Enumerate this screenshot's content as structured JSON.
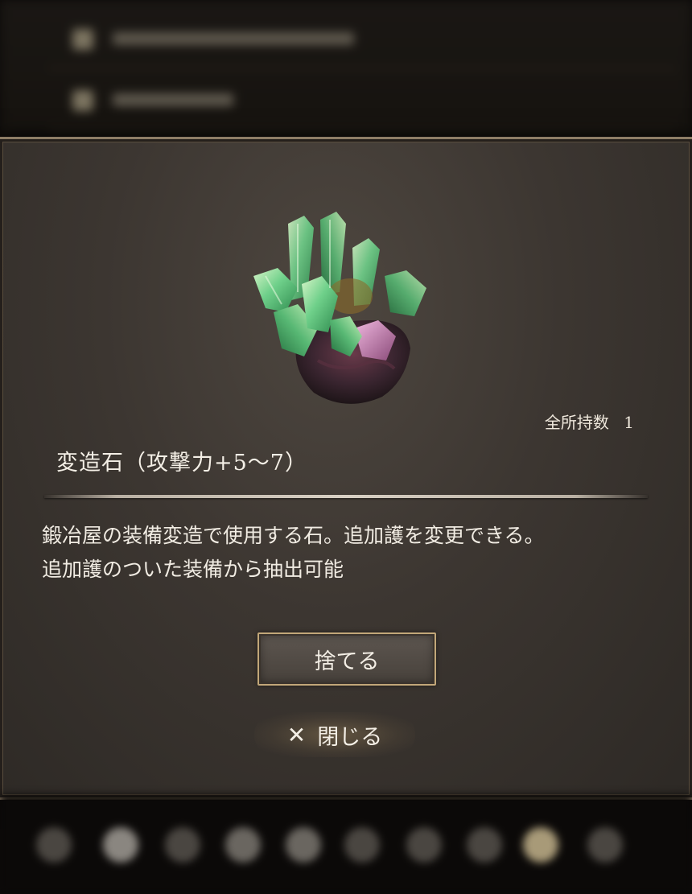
{
  "item": {
    "name": "変造石（攻撃力+5～7）",
    "count_label": "全所持数",
    "count_value": "1",
    "description_lines": [
      "鍛冶屋の装備変造で使用する石。追加護を変更できる。",
      "追加護のついた装備から抽出可能"
    ],
    "icon": "green-crystal-cluster-icon"
  },
  "buttons": {
    "discard_label": "捨てる",
    "close_label": "閉じる",
    "close_icon": "✕"
  },
  "colors": {
    "accent_border": "#c2a779",
    "panel_bg": "#3c3631",
    "text": "#f4efe6",
    "crystal_green": "#5fc27a"
  }
}
